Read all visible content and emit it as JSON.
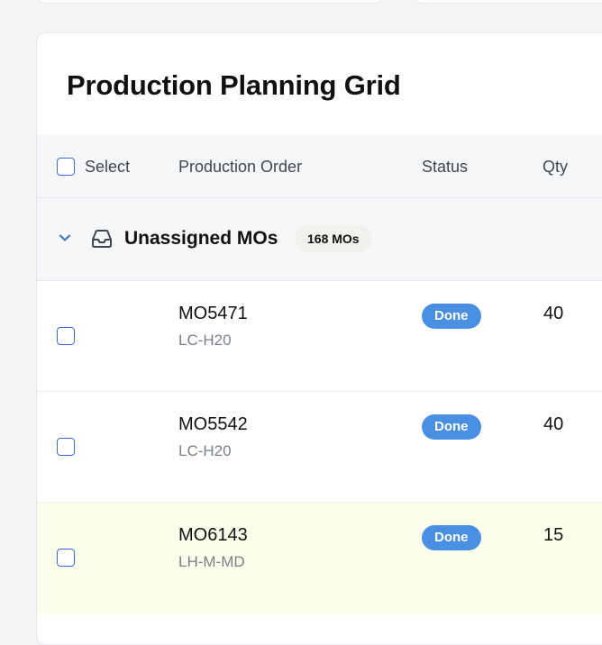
{
  "page": {
    "title": "Production Planning Grid"
  },
  "table": {
    "columns": [
      "Select",
      "Production Order",
      "Status",
      "Qty"
    ]
  },
  "group": {
    "title": "Unassigned MOs",
    "count_label": "168 MOs",
    "icon": "inbox-icon"
  },
  "rows": [
    {
      "mo": "MO5471",
      "sku": "LC-H20",
      "status": "Done",
      "qty": "40",
      "highlighted": false
    },
    {
      "mo": "MO5542",
      "sku": "LC-H20",
      "status": "Done",
      "qty": "40",
      "highlighted": false
    },
    {
      "mo": "MO6143",
      "sku": "LH-M-MD",
      "status": "Done",
      "qty": "15",
      "highlighted": true
    }
  ],
  "colors": {
    "accent": "#3b6fd8",
    "status_done": "#4a90e2",
    "highlight_row": "#fdfdeb",
    "header_bg": "#f6f7f9"
  }
}
